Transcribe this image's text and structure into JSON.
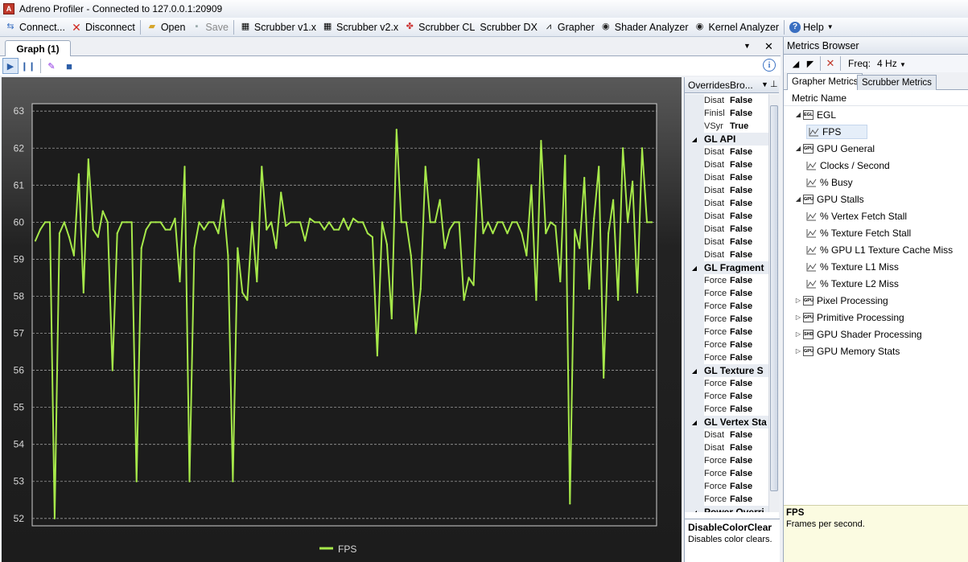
{
  "window": {
    "title": "Adreno Profiler - Connected to 127.0.0.1:20909"
  },
  "toolbar": {
    "items": [
      {
        "label": "Connect...",
        "icon": "connect-icon"
      },
      {
        "label": "Disconnect",
        "icon": "disconnect-icon"
      },
      {
        "label": "Open",
        "icon": "folder-open-icon"
      },
      {
        "label": "Save",
        "icon": "save-icon",
        "disabled": true
      },
      {
        "label": "Scrubber v1.x",
        "icon": "scrubber-icon"
      },
      {
        "label": "Scrubber v2.x",
        "icon": "scrubber-icon"
      },
      {
        "label": "Scrubber CL",
        "icon": "scrubber-cl-icon"
      },
      {
        "label": "Scrubber DX",
        "icon": ""
      },
      {
        "label": "Grapher",
        "icon": "grapher-icon"
      },
      {
        "label": "Shader Analyzer",
        "icon": "shader-icon"
      },
      {
        "label": "Kernel Analyzer",
        "icon": "kernel-icon"
      },
      {
        "label": "Help",
        "icon": "help-icon"
      }
    ]
  },
  "graph": {
    "tab_label": "Graph (1)"
  },
  "overrides": {
    "title": "OverridesBro...",
    "rows": [
      {
        "name": "Disat",
        "value": "False"
      },
      {
        "name": "Finisl",
        "value": "False"
      },
      {
        "name": "VSyr",
        "value": "True"
      },
      {
        "category": "GL API"
      },
      {
        "name": "Disat",
        "value": "False"
      },
      {
        "name": "Disat",
        "value": "False"
      },
      {
        "name": "Disat",
        "value": "False"
      },
      {
        "name": "Disat",
        "value": "False"
      },
      {
        "name": "Disat",
        "value": "False"
      },
      {
        "name": "Disat",
        "value": "False"
      },
      {
        "name": "Disat",
        "value": "False"
      },
      {
        "name": "Disat",
        "value": "False"
      },
      {
        "name": "Disat",
        "value": "False"
      },
      {
        "category": "GL Fragment"
      },
      {
        "name": "Force",
        "value": "False"
      },
      {
        "name": "Force",
        "value": "False"
      },
      {
        "name": "Force",
        "value": "False"
      },
      {
        "name": "Force",
        "value": "False"
      },
      {
        "name": "Force",
        "value": "False"
      },
      {
        "name": "Force",
        "value": "False"
      },
      {
        "name": "Force",
        "value": "False"
      },
      {
        "category": "GL Texture S"
      },
      {
        "name": "Force",
        "value": "False"
      },
      {
        "name": "Force",
        "value": "False"
      },
      {
        "name": "Force",
        "value": "False"
      },
      {
        "category": "GL Vertex Sta"
      },
      {
        "name": "Disat",
        "value": "False"
      },
      {
        "name": "Disat",
        "value": "False"
      },
      {
        "name": "Force",
        "value": "False"
      },
      {
        "name": "Force",
        "value": "False"
      },
      {
        "name": "Force",
        "value": "False"
      },
      {
        "name": "Force",
        "value": "False"
      },
      {
        "category": "Power Overri"
      }
    ],
    "description": {
      "title": "DisableColorClear",
      "text": "Disables color clears."
    }
  },
  "metrics": {
    "title": "Metrics Browser",
    "freq_label": "Freq:",
    "freq_value": "4 Hz",
    "tabs": [
      "Grapher Metrics",
      "Scrubber Metrics"
    ],
    "column": "Metric Name",
    "tree": [
      {
        "label": "EGL",
        "level": 0,
        "expanded": true,
        "group_icon": "EGL"
      },
      {
        "label": "FPS",
        "level": 1,
        "selected": true
      },
      {
        "label": "GPU General",
        "level": 0,
        "expanded": true,
        "group_icon": "GPU"
      },
      {
        "label": "Clocks / Second",
        "level": 1
      },
      {
        "label": "% Busy",
        "level": 1
      },
      {
        "label": "GPU Stalls",
        "level": 0,
        "expanded": true,
        "group_icon": "GPU"
      },
      {
        "label": "% Vertex Fetch Stall",
        "level": 1
      },
      {
        "label": "% Texture Fetch Stall",
        "level": 1
      },
      {
        "label": "% GPU L1 Texture Cache Miss",
        "level": 1
      },
      {
        "label": "% Texture L1 Miss",
        "level": 1
      },
      {
        "label": "% Texture L2 Miss",
        "level": 1
      },
      {
        "label": "Pixel Processing",
        "level": 0,
        "expanded": false,
        "group_icon": "GPU"
      },
      {
        "label": "Primitive Processing",
        "level": 0,
        "expanded": false,
        "group_icon": "GPU"
      },
      {
        "label": "GPU Shader Processing",
        "level": 0,
        "expanded": false,
        "group_icon": "SHD"
      },
      {
        "label": "GPU Memory Stats",
        "level": 0,
        "expanded": false,
        "group_icon": "GPU"
      }
    ],
    "description": {
      "title": "FPS",
      "text": "Frames per second."
    }
  },
  "chart_data": {
    "type": "line",
    "title": "",
    "xlabel": "",
    "ylabel": "",
    "ylim": [
      51.8,
      63.2
    ],
    "yticks": [
      52,
      53,
      54,
      55,
      56,
      57,
      58,
      59,
      60,
      61,
      62,
      63
    ],
    "grid": true,
    "legend_position": "bottom-center",
    "series": [
      {
        "name": "FPS",
        "color": "#a6e84a",
        "values": [
          59.5,
          59.8,
          60,
          60,
          52,
          59.7,
          60,
          59.6,
          59.1,
          61.3,
          58.1,
          61.7,
          59.8,
          59.6,
          60.3,
          60,
          56,
          59.7,
          60,
          60,
          60,
          53,
          59.3,
          59.8,
          60,
          60,
          60,
          59.8,
          59.8,
          60.1,
          58.4,
          61.5,
          53,
          59.3,
          60,
          59.8,
          60,
          60,
          59.7,
          60.6,
          59.1,
          53,
          59.3,
          58.1,
          57.9,
          60,
          58.4,
          61.5,
          59.8,
          60,
          59.3,
          60.8,
          59.9,
          60,
          60,
          60,
          59.5,
          60.1,
          60,
          60,
          59.8,
          60,
          59.8,
          59.8,
          60.1,
          59.8,
          60.1,
          60,
          60,
          59.7,
          59.6,
          56.4,
          60,
          59.4,
          57.4,
          62.5,
          60,
          60,
          59.1,
          57,
          58.2,
          61.5,
          60,
          60,
          60.6,
          59.3,
          59.8,
          60,
          60,
          57.9,
          58.5,
          58.3,
          61.7,
          59.7,
          60,
          59.7,
          60,
          60,
          59.7,
          60,
          60,
          59.7,
          59.1,
          61,
          57.9,
          62.2,
          59.7,
          60,
          59.9,
          58.4,
          61.8,
          52.4,
          59.8,
          59.3,
          61.2,
          58.2,
          60.1,
          61.5,
          55.8,
          59.7,
          60.6,
          57.9,
          62,
          60,
          61.1,
          58.1,
          62,
          60,
          60
        ]
      }
    ]
  }
}
